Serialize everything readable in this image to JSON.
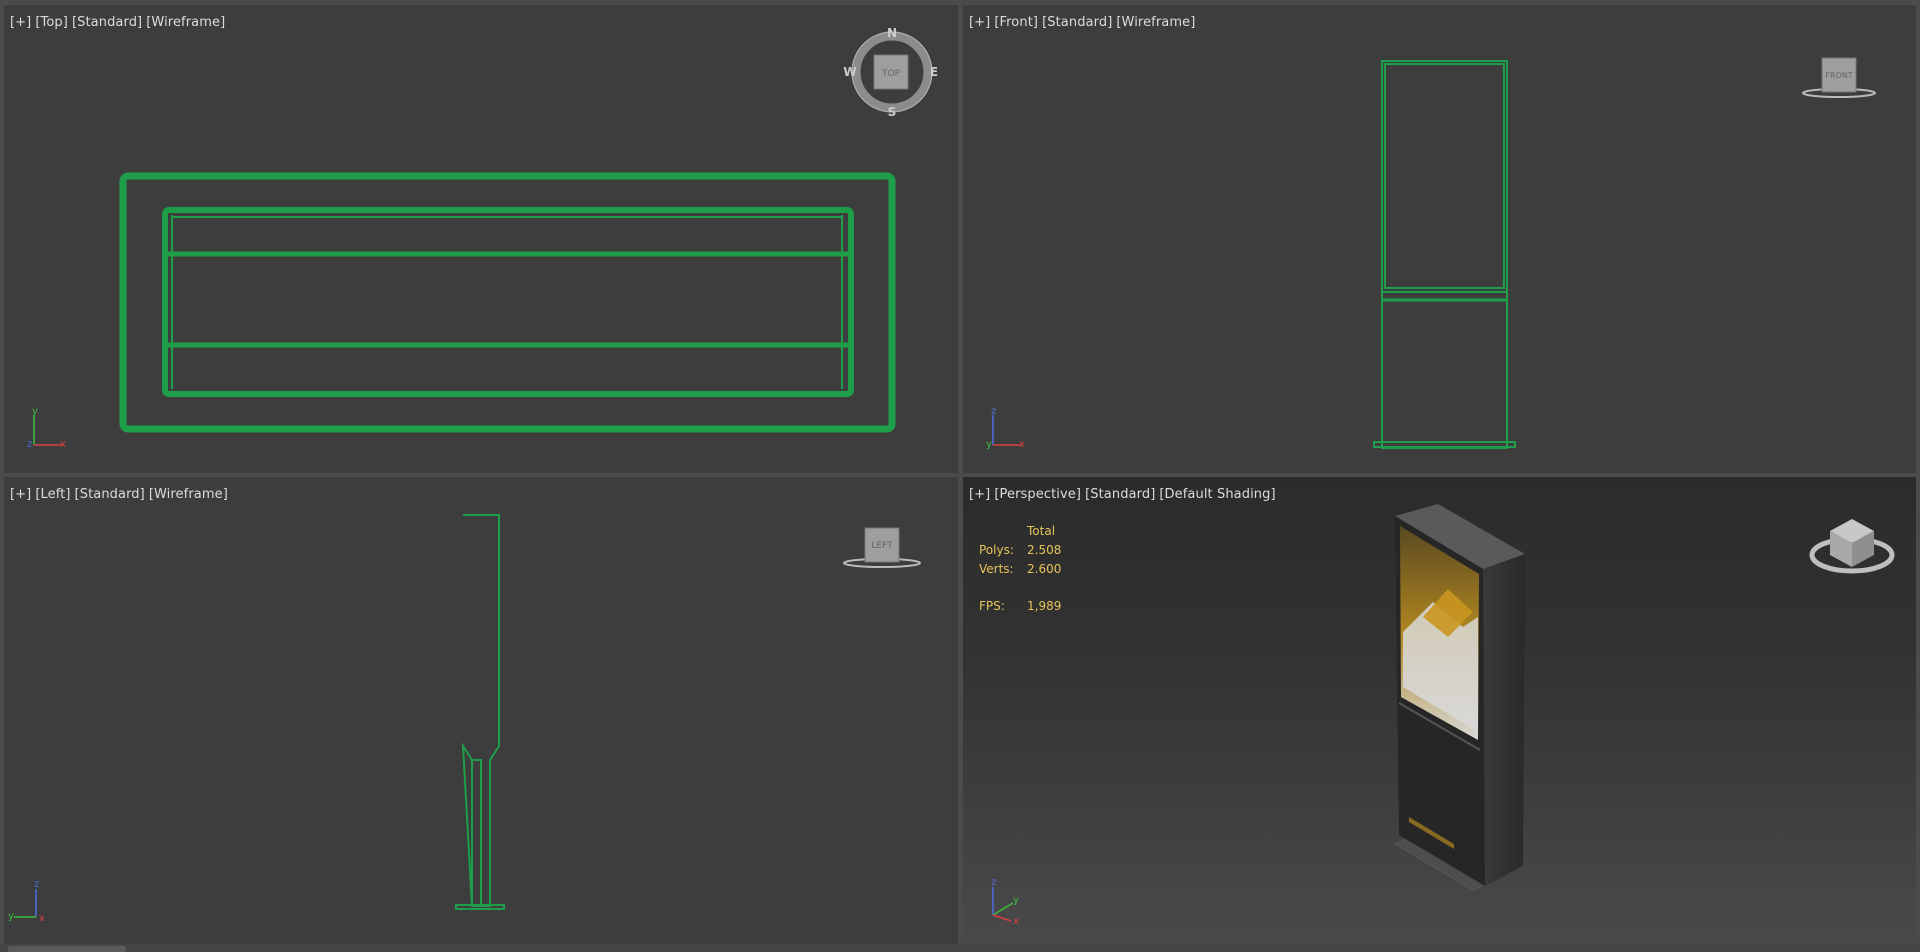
{
  "viewports": {
    "top": {
      "labels": [
        "[+]",
        "[Top]",
        "[Standard]",
        "[Wireframe]"
      ],
      "cube_face": "TOP",
      "compass": {
        "n": "N",
        "s": "S",
        "e": "E",
        "w": "W"
      },
      "axes": {
        "a": "y",
        "b": "x",
        "c": "z"
      }
    },
    "front": {
      "labels": [
        "[+]",
        "[Front]",
        "[Standard]",
        "[Wireframe]"
      ],
      "cube_face": "FRONT",
      "axes": {
        "a": "z",
        "b": "x",
        "c": "y"
      }
    },
    "left": {
      "labels": [
        "[+]",
        "[Left]",
        "[Standard]",
        "[Wireframe]"
      ],
      "cube_face": "LEFT",
      "axes": {
        "a": "z",
        "b": "y",
        "c": "x"
      }
    },
    "perspective": {
      "labels": [
        "[+]",
        "[Perspective]",
        "[Standard]",
        "[Default Shading]"
      ],
      "stats": {
        "total_label": "Total",
        "polys_label": "Polys:",
        "polys_value": "2.508",
        "verts_label": "Verts:",
        "verts_value": "2.600",
        "fps_label": "FPS:",
        "fps_value": "1,989"
      },
      "axes": {
        "a": "z",
        "b": "y",
        "c": "x"
      }
    }
  },
  "colors": {
    "wire": "#1e9e48",
    "active_border": "#c7a24a",
    "stats": "#e6c35a",
    "poster_accent": "#c9961f"
  }
}
